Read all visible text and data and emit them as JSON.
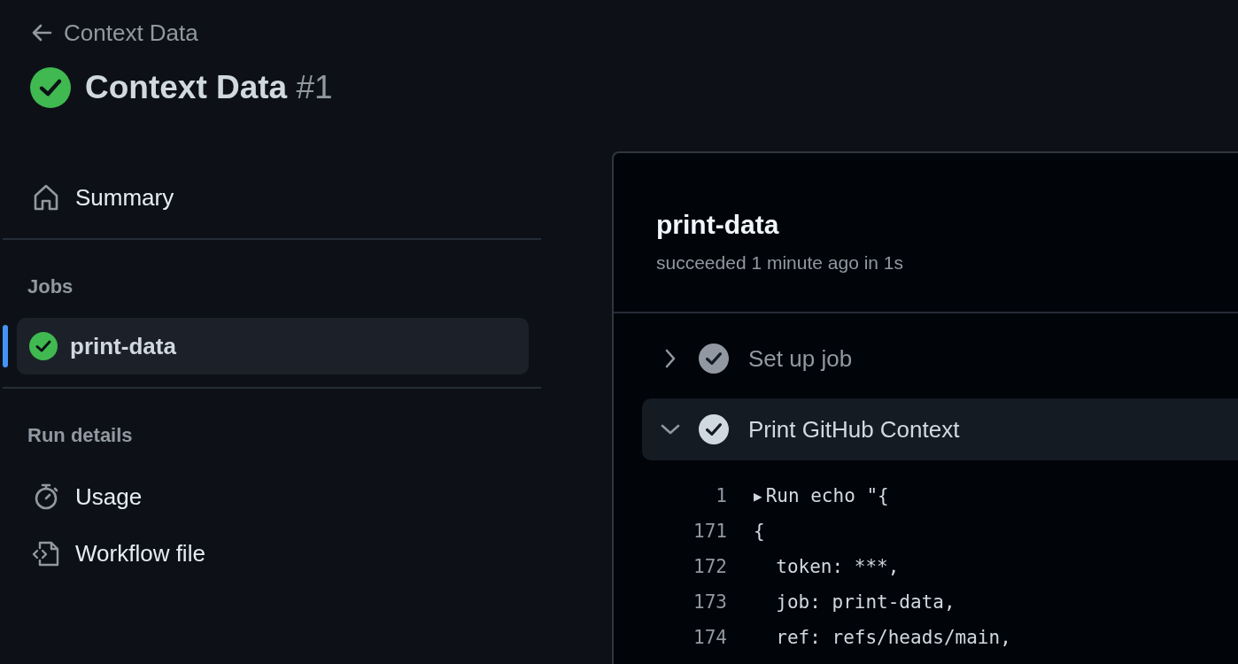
{
  "header": {
    "back_link": "Context Data",
    "title": "Context Data",
    "run_number": "#1",
    "status": {
      "kind": "success"
    }
  },
  "sidebar": {
    "summary": {
      "kind": "summary",
      "label": "Summary"
    },
    "jobs_heading": "Jobs",
    "jobs": [
      {
        "label": "print-data",
        "status": {
          "kind": "success"
        },
        "selected": true
      }
    ],
    "run_details_heading": "Run details",
    "run_details": [
      {
        "kind": "usage",
        "label": "Usage"
      },
      {
        "kind": "workflow",
        "label": "Workflow file"
      }
    ]
  },
  "job": {
    "title": "print-data",
    "subtitle": "succeeded 1 minute ago in 1s",
    "steps": [
      {
        "label": "Set up job",
        "expanded": false
      },
      {
        "label": "Print GitHub Context",
        "expanded": true
      }
    ],
    "log": [
      {
        "number": "1",
        "disclosure": "▶",
        "text": "Run echo \"{"
      },
      {
        "number": "171",
        "text": "{"
      },
      {
        "number": "172",
        "text": "  token: ***,"
      },
      {
        "number": "173",
        "text": "  job: print-data,"
      },
      {
        "number": "174",
        "text": "  ref: refs/heads/main,"
      }
    ]
  }
}
